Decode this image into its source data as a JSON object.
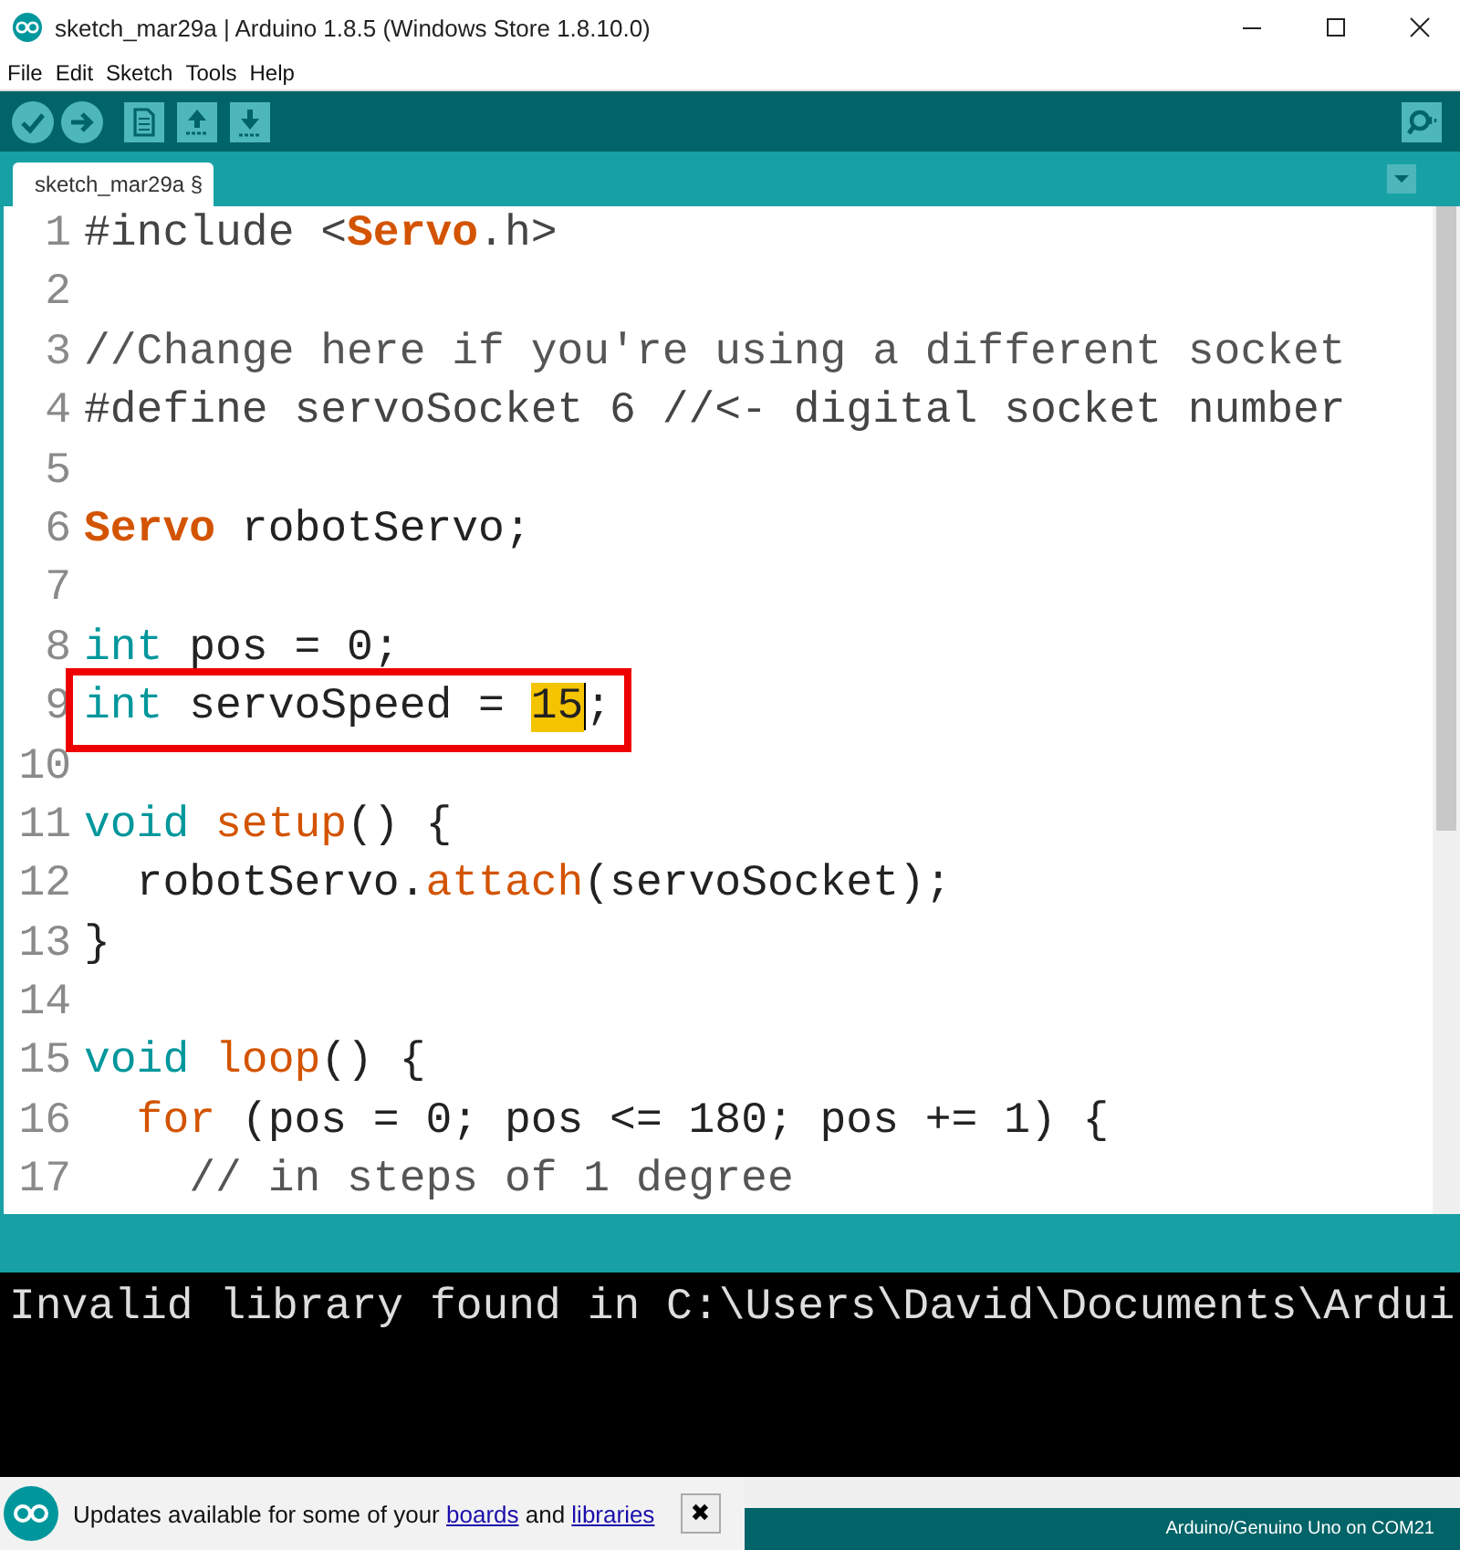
{
  "window": {
    "title": "sketch_mar29a | Arduino 1.8.5 (Windows Store 1.8.10.0)"
  },
  "menu": [
    "File",
    "Edit",
    "Sketch",
    "Tools",
    "Help"
  ],
  "tabs": [
    {
      "label": "sketch_mar29a §",
      "selected": true
    }
  ],
  "editor": {
    "lines": [
      {
        "number": "1",
        "boxed": false,
        "tokens": [
          {
            "text": "#include <",
            "kind": "preproc"
          },
          {
            "text": "Servo",
            "kind": "type"
          },
          {
            "text": ".h>",
            "kind": "preproc"
          }
        ]
      },
      {
        "number": "2",
        "boxed": false
      },
      {
        "number": "3",
        "boxed": false,
        "tokens": [
          {
            "text": "//Change here if you're using a different socket",
            "kind": "comment"
          }
        ]
      },
      {
        "number": "4",
        "boxed": false,
        "tokens": [
          {
            "text": "#define servoSocket 6 //<- digital socket number",
            "kind": "preproc"
          }
        ]
      },
      {
        "number": "5",
        "boxed": false
      },
      {
        "number": "6",
        "boxed": false,
        "tokens": [
          {
            "text": "Servo",
            "kind": "type"
          },
          {
            "text": " robotServo;",
            "kind": "plain"
          }
        ]
      },
      {
        "number": "7",
        "boxed": false
      },
      {
        "number": "8",
        "boxed": false,
        "tokens": [
          {
            "text": "int",
            "kind": "keyword"
          },
          {
            "text": " pos = 0;",
            "kind": "plain"
          }
        ]
      },
      {
        "number": "9",
        "boxed": true,
        "tokens": [
          {
            "text": "int",
            "kind": "keyword"
          },
          {
            "text": " servoSpeed = ",
            "kind": "plain"
          },
          {
            "text": "15",
            "kind": "match"
          },
          {
            "text": ";",
            "kind": "plain"
          }
        ]
      },
      {
        "number": "10",
        "boxed": false
      },
      {
        "number": "11",
        "boxed": false,
        "tokens": [
          {
            "text": "void ",
            "kind": "keyword"
          },
          {
            "text": "setup",
            "kind": "function"
          },
          {
            "text": "() {",
            "kind": "plain"
          }
        ]
      },
      {
        "number": "12",
        "boxed": false,
        "tokens": [
          {
            "text": "  robotServo.",
            "kind": "plain"
          },
          {
            "text": "attach",
            "kind": "function"
          },
          {
            "text": "(servoSocket);",
            "kind": "plain"
          }
        ]
      },
      {
        "number": "13",
        "boxed": false,
        "tokens": [
          {
            "text": "}",
            "kind": "plain"
          }
        ]
      },
      {
        "number": "14",
        "boxed": false
      },
      {
        "number": "15",
        "boxed": false,
        "tokens": [
          {
            "text": "void ",
            "kind": "keyword"
          },
          {
            "text": "loop",
            "kind": "function"
          },
          {
            "text": "() {",
            "kind": "plain"
          }
        ]
      },
      {
        "number": "16",
        "boxed": false,
        "tokens": [
          {
            "text": "  for",
            "kind": "function"
          },
          {
            "text": " (pos = 0; pos <= 180; pos += 1) {",
            "kind": "plain"
          }
        ]
      },
      {
        "number": "17",
        "boxed": false,
        "tokens": [
          {
            "text": "    // in steps of 1 degree",
            "kind": "comment"
          }
        ]
      }
    ]
  },
  "console": {
    "lines": [
      "Invalid library found in C:\\Users\\David\\Documents\\Ardui"
    ]
  },
  "notification": {
    "parts": [
      {
        "text": "Updates available for some of your ",
        "kind": "text"
      },
      {
        "text": "boards",
        "kind": "link"
      },
      {
        "text": " and ",
        "kind": "text"
      },
      {
        "text": "libraries",
        "kind": "link"
      }
    ],
    "close": "✖"
  },
  "status_bar": {
    "board": "Arduino/Genuino Uno on COM21"
  }
}
